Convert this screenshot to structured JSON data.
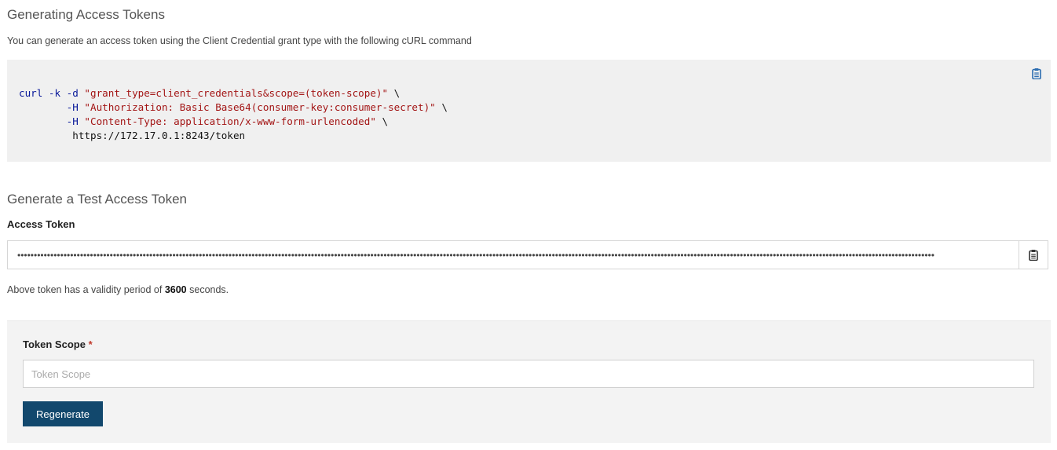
{
  "header": {
    "title": "Generating Access Tokens",
    "subtitle": "You can generate an access token using the Client Credential grant type with the following cURL command"
  },
  "code": {
    "line1_cmd": "curl -k -d ",
    "line1_str": "\"grant_type=client_credentials&scope=(token-scope)\"",
    "line1_tail": " \\",
    "line2_flag": "        -H ",
    "line2_str": "\"Authorization: Basic Base64(consumer-key:consumer-secret)\"",
    "line2_tail": " \\",
    "line3_flag": "        -H ",
    "line3_str": "\"Content-Type: application/x-www-form-urlencoded\"",
    "line3_tail": " \\",
    "line4": "         https://172.17.0.1:8243/token",
    "copy_icon": "clipboard-icon"
  },
  "test_token": {
    "title": "Generate a Test Access Token",
    "label": "Access Token",
    "value": "••••••••••••••••••••••••••••••••••••••••••••••••••••••••••••••••••••••••••••••••••••••••••••••••••••••••••••••••••••••••••••••••••••••••••••••••••••••••••••••••••••••••••••••••••••••••••••••••••••••••••••••••••••••••••••••••••••••••••••••••••••••••••••••••••••••••••••••••••••••",
    "copy_icon": "clipboard-icon",
    "validity_prefix": "Above token has a validity period of ",
    "validity_value": "3600",
    "validity_suffix": " seconds."
  },
  "scope": {
    "label": "Token Scope",
    "required_mark": "*",
    "placeholder": "Token Scope",
    "button_label": "Regenerate"
  },
  "colors": {
    "accent": "#12486d",
    "code_keyword": "#0a1a9a",
    "code_string": "#a31515",
    "required": "#c0392b"
  }
}
